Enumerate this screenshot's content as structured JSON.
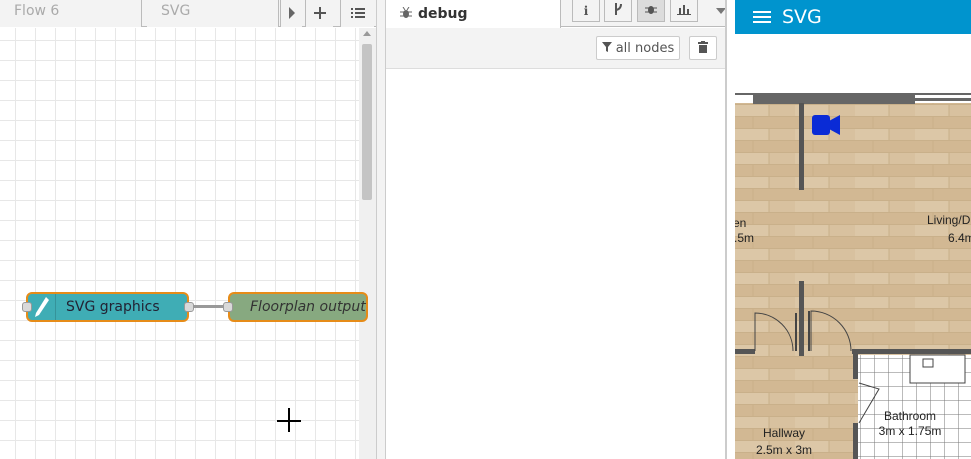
{
  "workspace": {
    "tabs": [
      {
        "label": "Flow 6"
      },
      {
        "label": "SVG"
      }
    ],
    "nodes": {
      "svg_graphics": {
        "label": "SVG graphics",
        "color": "#3fadb5"
      },
      "floorplan_output": {
        "label": "Floorplan output",
        "color": "#87a980"
      }
    }
  },
  "sidebar": {
    "active_tab": "debug",
    "filter_label": "all nodes"
  },
  "dashboard": {
    "title": "SVG",
    "header_color": "#0094ce",
    "floorplan": {
      "rooms": [
        {
          "name": "en",
          "size": ".5m"
        },
        {
          "name": "Living/D",
          "size": "6.4m"
        },
        {
          "name": "Hallway",
          "size": "2.5m x 3m"
        },
        {
          "name": "Bathroom",
          "size": "3m x 1.75m"
        }
      ],
      "camera_color": "#0a2bd6"
    }
  }
}
